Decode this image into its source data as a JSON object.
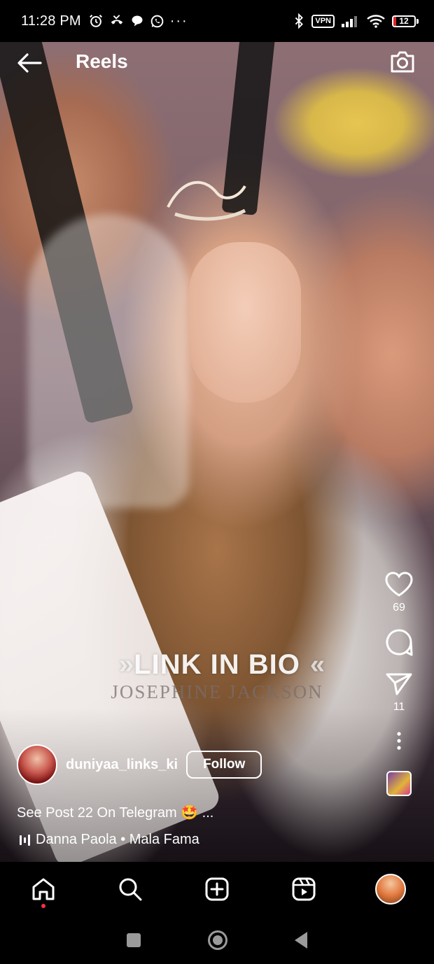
{
  "status_bar": {
    "time": "11:28 PM",
    "left_icons": [
      "alarm-icon",
      "missed-call-icon",
      "chat-bubble-icon",
      "whatsapp-icon",
      "more-dots-icon"
    ],
    "more": "···",
    "right_icons": [
      "bluetooth-icon",
      "vpn-badge",
      "signal-icon",
      "wifi-icon",
      "battery-icon"
    ],
    "vpn": "VPN",
    "battery_level": "12",
    "battery_fraction": 0.12
  },
  "header": {
    "title": "Reels"
  },
  "video": {
    "overlay_text": "LINK IN BIO",
    "overlay_subtext": "JOSEPHINE JACKSON",
    "chevrons_left": "»",
    "chevrons_right": "«"
  },
  "actions": {
    "likes": "69",
    "shares": "11"
  },
  "post": {
    "username": "duniyaa_links_ki",
    "follow_label": "Follow",
    "caption": "See Post 22 On Telegram 🤩 ...",
    "audio": "Danna Paola • Mala Fama"
  },
  "bottom_nav": {
    "items": [
      "home-icon",
      "search-icon",
      "create-icon",
      "reels-icon",
      "profile-avatar"
    ]
  },
  "colors": {
    "background": "#000000",
    "notification_dot": "#ff3040",
    "battery_low": "#e2262a"
  }
}
